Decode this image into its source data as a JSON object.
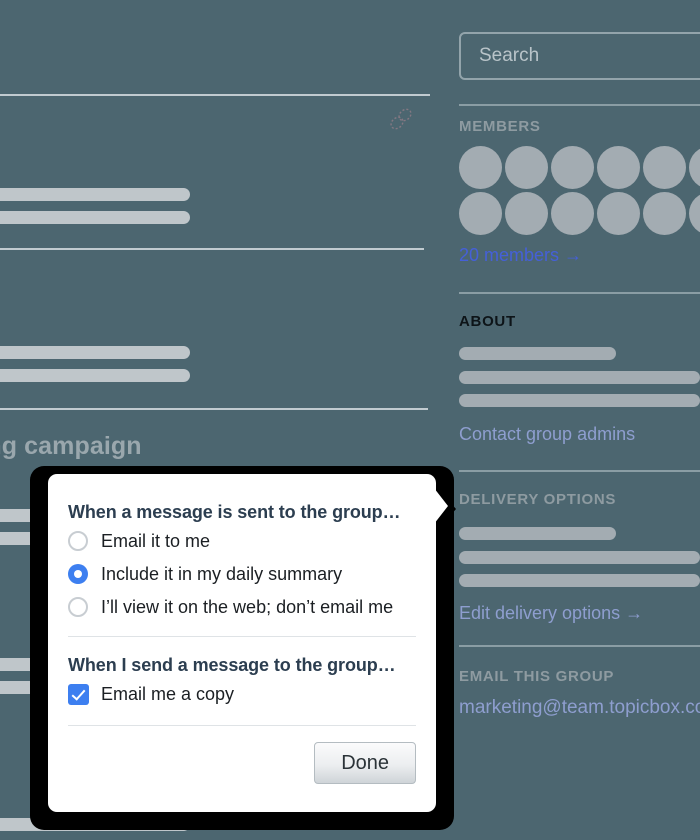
{
  "background": {
    "color": "#4c6670",
    "page_heading": "rtising campaign",
    "link_icon": "link-icon"
  },
  "sidebar": {
    "search": {
      "placeholder": "Search",
      "value": ""
    },
    "members": {
      "heading": "MEMBERS",
      "avatar_count": 12,
      "link": "20 members →"
    },
    "about": {
      "heading": "ABOUT",
      "link": "Contact group admins"
    },
    "delivery": {
      "heading": "DELIVERY OPTIONS",
      "link": "Edit delivery options →"
    },
    "email_group": {
      "heading": "EMAIL THIS GROUP",
      "address": "marketing@team.topicbox.co"
    }
  },
  "modal": {
    "receive_title": "When a message is sent to the group…",
    "receive_options": [
      {
        "label": "Email it to me",
        "selected": false
      },
      {
        "label": "Include it in my daily summary",
        "selected": true
      },
      {
        "label": "I’ll view it on the web; don’t email me",
        "selected": false
      }
    ],
    "send_title": "When I send a message to the group…",
    "send_option": {
      "label": "Email me a copy",
      "checked": true
    },
    "done_label": "Done"
  },
  "colors": {
    "background": "#4c6670",
    "accent_blue": "#3d7ff0",
    "link_blue": "#4560d8",
    "link_soft": "#8e9ecf",
    "skeleton": "#bfc6ca",
    "avatar": "#a3acb2"
  }
}
